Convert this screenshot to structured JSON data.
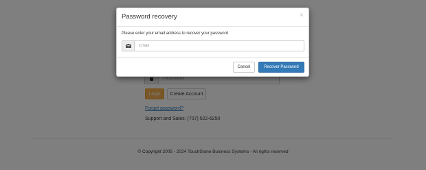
{
  "login": {
    "password_placeholder": "Password",
    "login_label": "Login",
    "create_account_label": "Create Account",
    "forgot_password_label": "Forgot password?",
    "support_text": "Support and Sales: (707) 522-6250"
  },
  "footer": {
    "copyright": "© Copyright 2005 - 2024 TouchStone Business Systems - All rights reserved"
  },
  "modal": {
    "title": "Password recovery",
    "close_label": "×",
    "instructions": "Please enter your email address to recover your password",
    "email_placeholder": "Email",
    "email_value": "",
    "cancel_label": "Cancel",
    "recover_label": "Recover Password"
  },
  "icons": {
    "email": "envelope-icon",
    "password": "lock-icon"
  },
  "colors": {
    "primary": "#337ab7",
    "warning": "#f0ad4e",
    "link": "#337ab7"
  }
}
